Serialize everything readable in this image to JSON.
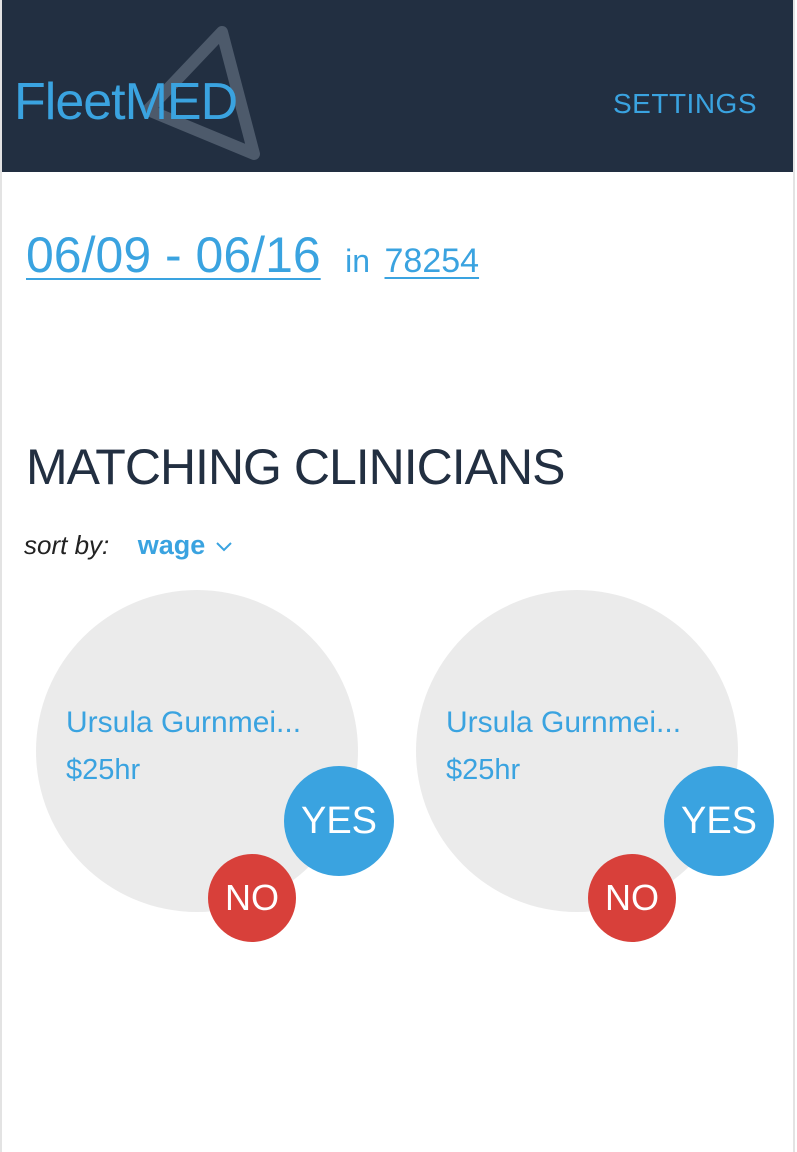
{
  "header": {
    "logo_part1": "Fleet",
    "logo_part2": "MED",
    "settings_label": "SETTINGS"
  },
  "search": {
    "date_range": "06/09 - 06/16",
    "in_label": "in",
    "zip": "78254"
  },
  "section": {
    "title": "MATCHING CLINICIANS"
  },
  "sort": {
    "label": "sort by:",
    "value": "wage"
  },
  "clinicians": [
    {
      "name": "Ursula Gurnmei...",
      "rate": "$25hr",
      "yes_label": "YES",
      "no_label": "NO"
    },
    {
      "name": "Ursula Gurnmei...",
      "rate": "$25hr",
      "yes_label": "YES",
      "no_label": "NO"
    }
  ],
  "colors": {
    "header_bg": "#222f41",
    "accent": "#3aa3e0",
    "no_red": "#d8403a",
    "card_bg": "#ebebeb"
  },
  "icons": {
    "logo": "triangle-logo-icon",
    "sort": "chevron-down-icon"
  }
}
